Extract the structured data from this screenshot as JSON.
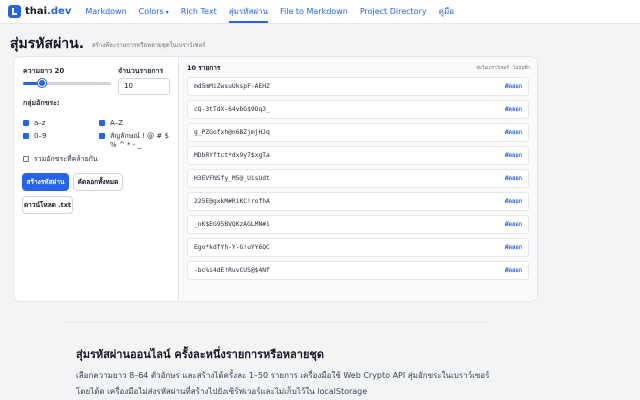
{
  "nav": {
    "brand_main": "thai",
    "brand_tld": ".dev",
    "links": [
      {
        "label": "Markdown",
        "caret": false,
        "active": false
      },
      {
        "label": "Colors",
        "caret": true,
        "active": false
      },
      {
        "label": "Rich Text",
        "caret": false,
        "active": false
      },
      {
        "label": "สุ่มรหัสผ่าน",
        "caret": false,
        "active": true
      },
      {
        "label": "File to Markdown",
        "caret": false,
        "active": false
      },
      {
        "label": "Project Directory",
        "caret": false,
        "active": false
      },
      {
        "label": "คู่มือ",
        "caret": false,
        "active": false
      }
    ]
  },
  "header": {
    "title": "สุ่มรหัสผ่าน.",
    "subtitle": "สร้างทีละรายการหรือหลายชุดในเบราว์เซอร์"
  },
  "controls": {
    "length_label": "ความยาว 20",
    "length_value": 20,
    "length_min": 8,
    "length_max": 64,
    "count_label": "จำนวนรายการ",
    "count_value": "10",
    "charset_label": "กลุ่มอักขระ:",
    "lower": "a–z",
    "upper": "A–Z",
    "digits": "0–9",
    "symbols_line1": "สัญลักษณ์ ! @ # $",
    "symbols_line2": "% ^ * - _",
    "ambiguous": "รวมอักขระที่คล้ายกัน",
    "generate_button": "สร้างรหัสผ่าน",
    "copy_all_button": "คัดลอกทั้งหมด",
    "download_button": "ดาวน์โหลด .txt"
  },
  "results": {
    "count_text": "10 รายการ",
    "note": "สุ่มในเบราว์เซอร์ · ไม่บันทึก",
    "copy_label": "คัดลอก",
    "items": [
      "md5mMiZwsuUkspF-AEHZ",
      "cQ-3tTdX-64vbG$9Oq3_",
      "g_PZGofxh@n6BZjmjHJq",
      "MDbRYftct*dx9y7$xgTa",
      "H3EVFNSfy_M5@_UisUdt",
      "225E@gxkM#RiKC!rofhA",
      "_nK$EG95BVQKzAGLMN#i",
      "Ego*kdfYh-Y-G!uYY6QC",
      "-bc%i4dE!RuvCUS@$4Nf"
    ]
  },
  "article": {
    "heading": "สุ่มรหัสผ่านออนไลน์ ครั้งละหนึ่งรายการหรือหลายชุด",
    "paragraph": "เลือกความยาว 8–64 ตัวอักษร และสร้างได้ครั้งละ 1–50 รายการ เครื่องมือใช้ Web Crypto API สุ่มอักขระในเบราว์เซอร์ โดยได้ด เครื่องมือไม่ส่งรหัสผ่านที่สร้างไปยังเซิร์ฟเวอร์และไม่เก็บไว้ใน localStorage"
  }
}
